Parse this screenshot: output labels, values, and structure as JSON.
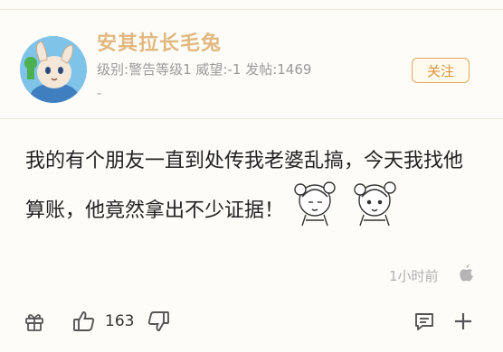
{
  "user": {
    "name": "安其拉长毛兔",
    "level_label": "级别:",
    "level_value": "警告等级1",
    "prestige_label": "威望:",
    "prestige_value": "-1",
    "posts_label": "发帖:",
    "posts_value": "1469",
    "extra": "-"
  },
  "follow_button": "关注",
  "post": {
    "line1": "我的有个朋友一直到处传我老婆乱搞，今天我找他",
    "line2": "算账，他竟然拿出不少证据！",
    "time": "1小时前"
  },
  "toolbar": {
    "like_count": "163"
  },
  "icons": [
    "apple-icon",
    "gift-icon",
    "thumbs-up-icon",
    "thumbs-down-icon",
    "comment-icon",
    "plus-icon"
  ],
  "colors": {
    "username": "#e2b87f",
    "accent": "#d9953a",
    "text": "#222222",
    "muted": "#9a9a9a"
  }
}
